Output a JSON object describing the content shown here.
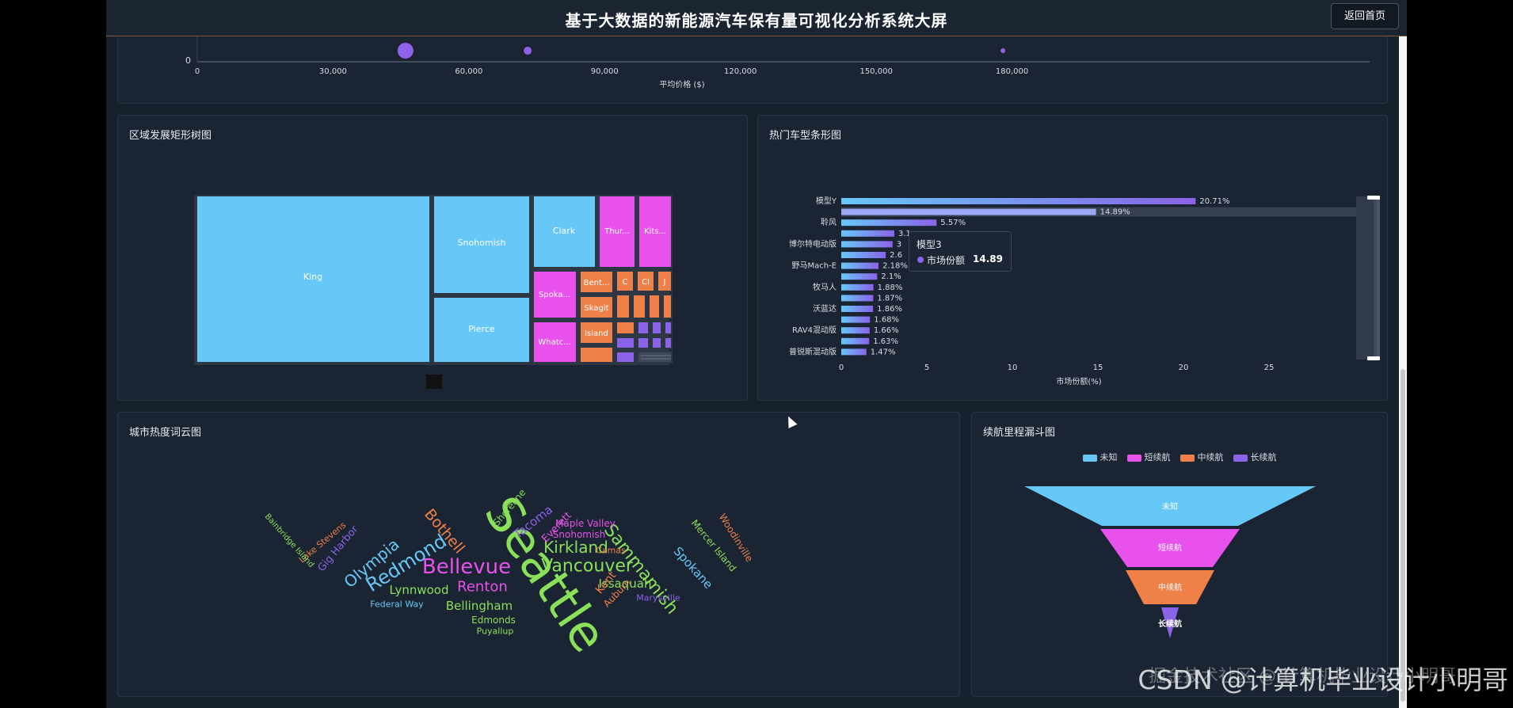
{
  "header": {
    "title": "基于大数据的新能源汽车保有量可视化分析系统大屏",
    "back_label": "返回首页"
  },
  "scatter_panel": {
    "xlabel": "平均价格 ($)",
    "y_tick": "0",
    "x_ticks": [
      "0",
      "30,000",
      "60,000",
      "90,000",
      "120,000",
      "150,000",
      "180,000"
    ],
    "points": [
      {
        "x": 46000,
        "r": 10,
        "color": "#8e63ea"
      },
      {
        "x": 73000,
        "r": 5,
        "color": "#8e63ea"
      },
      {
        "x": 178000,
        "r": 3,
        "color": "#8e63ea"
      }
    ]
  },
  "treemap_panel": {
    "title": "区域发展矩形树图",
    "labels": {
      "king": "King",
      "snohomish": "Snohomish",
      "pierce": "Pierce",
      "clark": "Clark",
      "thurston": "Thur...",
      "kitsap": "Kits...",
      "spokane": "Spoka...",
      "whatcom": "Whatc...",
      "benton": "Bent...",
      "skagit": "Skagit",
      "island": "Island",
      "c": "C",
      "cl": "Cl",
      "j": "J"
    },
    "colors": {
      "blue": "#67c8f7",
      "pink": "#e851ec",
      "orange": "#ee8048",
      "purple": "#8a63e8"
    }
  },
  "bar_panel": {
    "title": "热门车型条形图",
    "xlabel": "市场份额(%)",
    "x_ticks": [
      "0",
      "5",
      "10",
      "15",
      "20",
      "25"
    ],
    "rows": [
      {
        "label": "模型Y",
        "value": 20.71,
        "text": "20.71%"
      },
      {
        "label": "",
        "value": 14.89,
        "text": "14.89%"
      },
      {
        "label": "聆风",
        "value": 5.57,
        "text": "5.57%"
      },
      {
        "label": "",
        "value": 3.1,
        "text": "3.1"
      },
      {
        "label": "博尔特电动版",
        "value": 3.0,
        "text": "3"
      },
      {
        "label": "",
        "value": 2.6,
        "text": "2.6"
      },
      {
        "label": "野马Mach-E",
        "value": 2.18,
        "text": "2.18%"
      },
      {
        "label": "",
        "value": 2.1,
        "text": "2.1%"
      },
      {
        "label": "牧马人",
        "value": 1.88,
        "text": "1.88%"
      },
      {
        "label": "",
        "value": 1.87,
        "text": "1.87%"
      },
      {
        "label": "沃蓝达",
        "value": 1.86,
        "text": "1.86%"
      },
      {
        "label": "",
        "value": 1.68,
        "text": "1.68%"
      },
      {
        "label": "RAV4混动版",
        "value": 1.66,
        "text": "1.66%"
      },
      {
        "label": "",
        "value": 1.63,
        "text": "1.63%"
      },
      {
        "label": "普锐斯混动版",
        "value": 1.47,
        "text": "1.47%"
      }
    ],
    "tooltip": {
      "title": "模型3",
      "series": "市场份额",
      "value": "14.89"
    }
  },
  "wordcloud_panel": {
    "title": "城市热度词云图",
    "words": [
      {
        "text": "Seattle",
        "color": "#8be05a"
      },
      {
        "text": "Bellevue",
        "color": "#e851ec"
      },
      {
        "text": "Vancouver",
        "color": "#8be05a"
      },
      {
        "text": "Kirkland",
        "color": "#8be05a"
      },
      {
        "text": "Redmond",
        "color": "#67c8f7"
      },
      {
        "text": "Sammamish",
        "color": "#8be05a"
      },
      {
        "text": "Olympia",
        "color": "#67c8f7"
      },
      {
        "text": "Bothell",
        "color": "#ee8048"
      },
      {
        "text": "Renton",
        "color": "#e851ec"
      },
      {
        "text": "Lynnwood",
        "color": "#8be05a"
      },
      {
        "text": "Bellingham",
        "color": "#8be05a"
      },
      {
        "text": "Issaquah",
        "color": "#8be05a"
      },
      {
        "text": "Spokane",
        "color": "#67c8f7"
      },
      {
        "text": "Tacoma",
        "color": "#8a63e8"
      },
      {
        "text": "Everett",
        "color": "#e851ec"
      },
      {
        "text": "Shoreline",
        "color": "#8be05a"
      },
      {
        "text": "Maple Valley",
        "color": "#e851ec"
      },
      {
        "text": "Snohomish",
        "color": "#e851ec"
      },
      {
        "text": "Camas",
        "color": "#ee8048"
      },
      {
        "text": "Kent",
        "color": "#ee8048"
      },
      {
        "text": "Auburn",
        "color": "#ee8048"
      },
      {
        "text": "Marysville",
        "color": "#8a63e8"
      },
      {
        "text": "Mercer Island",
        "color": "#8be05a"
      },
      {
        "text": "Woodinville",
        "color": "#ee8048"
      },
      {
        "text": "Edmonds",
        "color": "#8be05a"
      },
      {
        "text": "Puyallup",
        "color": "#8be05a"
      },
      {
        "text": "Federal Way",
        "color": "#67c8f7"
      },
      {
        "text": "Gig Harbor",
        "color": "#8a63e8"
      },
      {
        "text": "Lake Stevens",
        "color": "#ee8048"
      },
      {
        "text": "Bainbridge Island",
        "color": "#8be05a"
      }
    ]
  },
  "funnel_panel": {
    "title": "续航里程漏斗图",
    "legend": [
      {
        "label": "未知",
        "color": "#67c8f7"
      },
      {
        "label": "短续航",
        "color": "#e851ec"
      },
      {
        "label": "中续航",
        "color": "#ee8048"
      },
      {
        "label": "长续航",
        "color": "#8a63e8"
      }
    ]
  },
  "watermark": "掘金技术社区 @ 计算机毕业设计小明哥",
  "watermark2": "CSDN @计算机毕业设计小明哥"
}
